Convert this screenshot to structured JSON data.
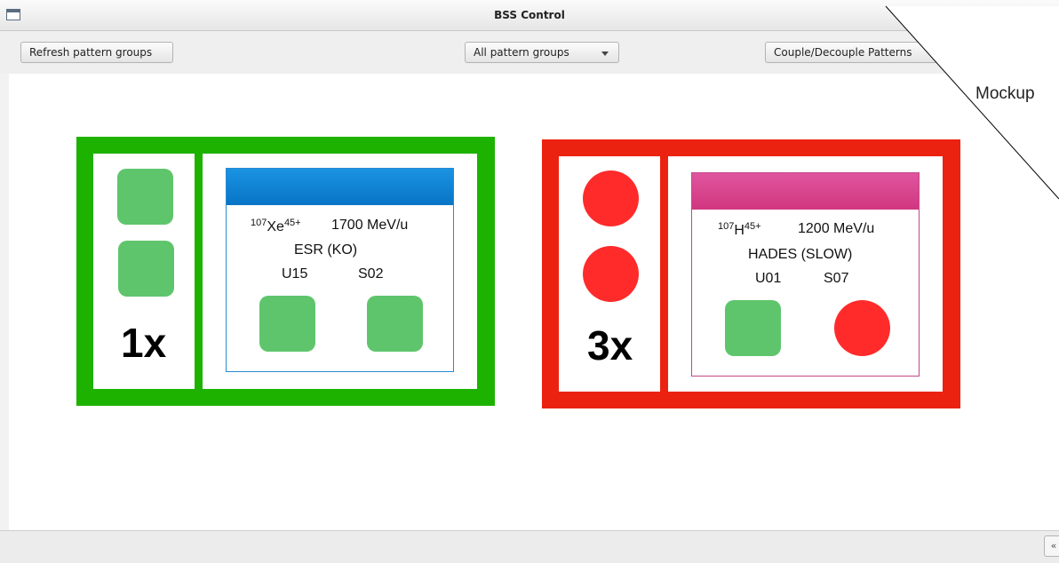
{
  "window": {
    "title": "BSS Control"
  },
  "toolbar": {
    "refresh_label": "Refresh pattern groups",
    "filter_selected": "All pattern groups",
    "couple_label": "Couple/Decouple Patterns"
  },
  "overlay": {
    "label": "Mockup"
  },
  "groups": [
    {
      "status_color": "#1eb200",
      "multiplier": "1x",
      "indicators": [
        "square-green",
        "square-green"
      ],
      "pattern": {
        "header_color": "#0a7fd0",
        "isotope_mass": "107",
        "element": "Xe",
        "charge": "45+",
        "energy": "1700 MeV/u",
        "destination": "ESR (KO)",
        "source": "U15",
        "segment": "S02",
        "indicators": [
          "square-green",
          "square-green"
        ]
      }
    },
    {
      "status_color": "#ec2211",
      "multiplier": "3x",
      "indicators": [
        "circle-red",
        "circle-red"
      ],
      "pattern": {
        "header_color": "#d93c90",
        "isotope_mass": "107",
        "element": "H",
        "charge": "45+",
        "energy": "1200 MeV/u",
        "destination": "HADES (SLOW)",
        "source": "U01",
        "segment": "S07",
        "indicators": [
          "square-green",
          "circle-red"
        ]
      }
    }
  ]
}
